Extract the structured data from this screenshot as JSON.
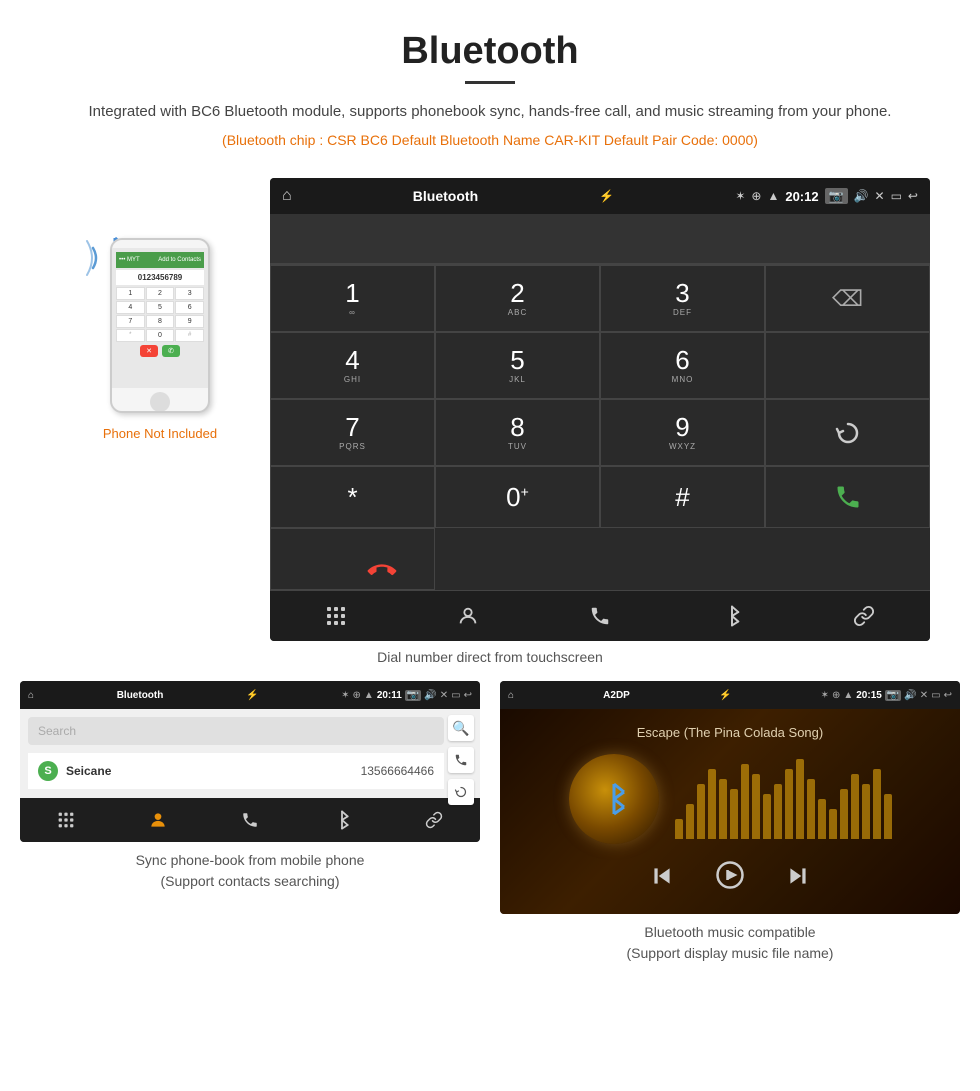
{
  "header": {
    "title": "Bluetooth",
    "description": "Integrated with BC6 Bluetooth module, supports phonebook sync, hands-free call, and music streaming from your phone.",
    "specs": "(Bluetooth chip : CSR BC6    Default Bluetooth Name CAR-KIT    Default Pair Code: 0000)"
  },
  "dialer": {
    "status": {
      "title": "Bluetooth",
      "time": "20:12"
    },
    "keys": [
      {
        "num": "1",
        "letters": "∞"
      },
      {
        "num": "2",
        "letters": "ABC"
      },
      {
        "num": "3",
        "letters": "DEF"
      },
      {
        "num": "4",
        "letters": "GHI"
      },
      {
        "num": "5",
        "letters": "JKL"
      },
      {
        "num": "6",
        "letters": "MNO"
      },
      {
        "num": "7",
        "letters": "PQRS"
      },
      {
        "num": "8",
        "letters": "TUV"
      },
      {
        "num": "9",
        "letters": "WXYZ"
      },
      {
        "num": "*",
        "letters": ""
      },
      {
        "num": "0",
        "letters": "+"
      },
      {
        "num": "#",
        "letters": ""
      }
    ],
    "caption": "Dial number direct from touchscreen"
  },
  "phone": {
    "not_included": "Phone Not Included"
  },
  "phonebook": {
    "status_title": "Bluetooth",
    "status_time": "20:11",
    "search_placeholder": "Search",
    "contacts": [
      {
        "letter": "S",
        "name": "Seicane",
        "phone": "13566664466"
      }
    ],
    "caption_line1": "Sync phone-book from mobile phone",
    "caption_line2": "(Support contacts searching)"
  },
  "a2dp": {
    "status_title": "A2DP",
    "status_time": "20:15",
    "song_title": "Escape (The Pina Colada Song)",
    "eq_bars": [
      20,
      35,
      55,
      70,
      60,
      50,
      75,
      65,
      45,
      55,
      70,
      80,
      60,
      40,
      30,
      50,
      65,
      55,
      70,
      45
    ],
    "caption_line1": "Bluetooth music compatible",
    "caption_line2": "(Support display music file name)"
  },
  "toolbar": {
    "dialpad_icon": "⊞",
    "contacts_icon": "👤",
    "phone_icon": "📞",
    "bluetooth_icon": "⚡",
    "link_icon": "🔗"
  }
}
